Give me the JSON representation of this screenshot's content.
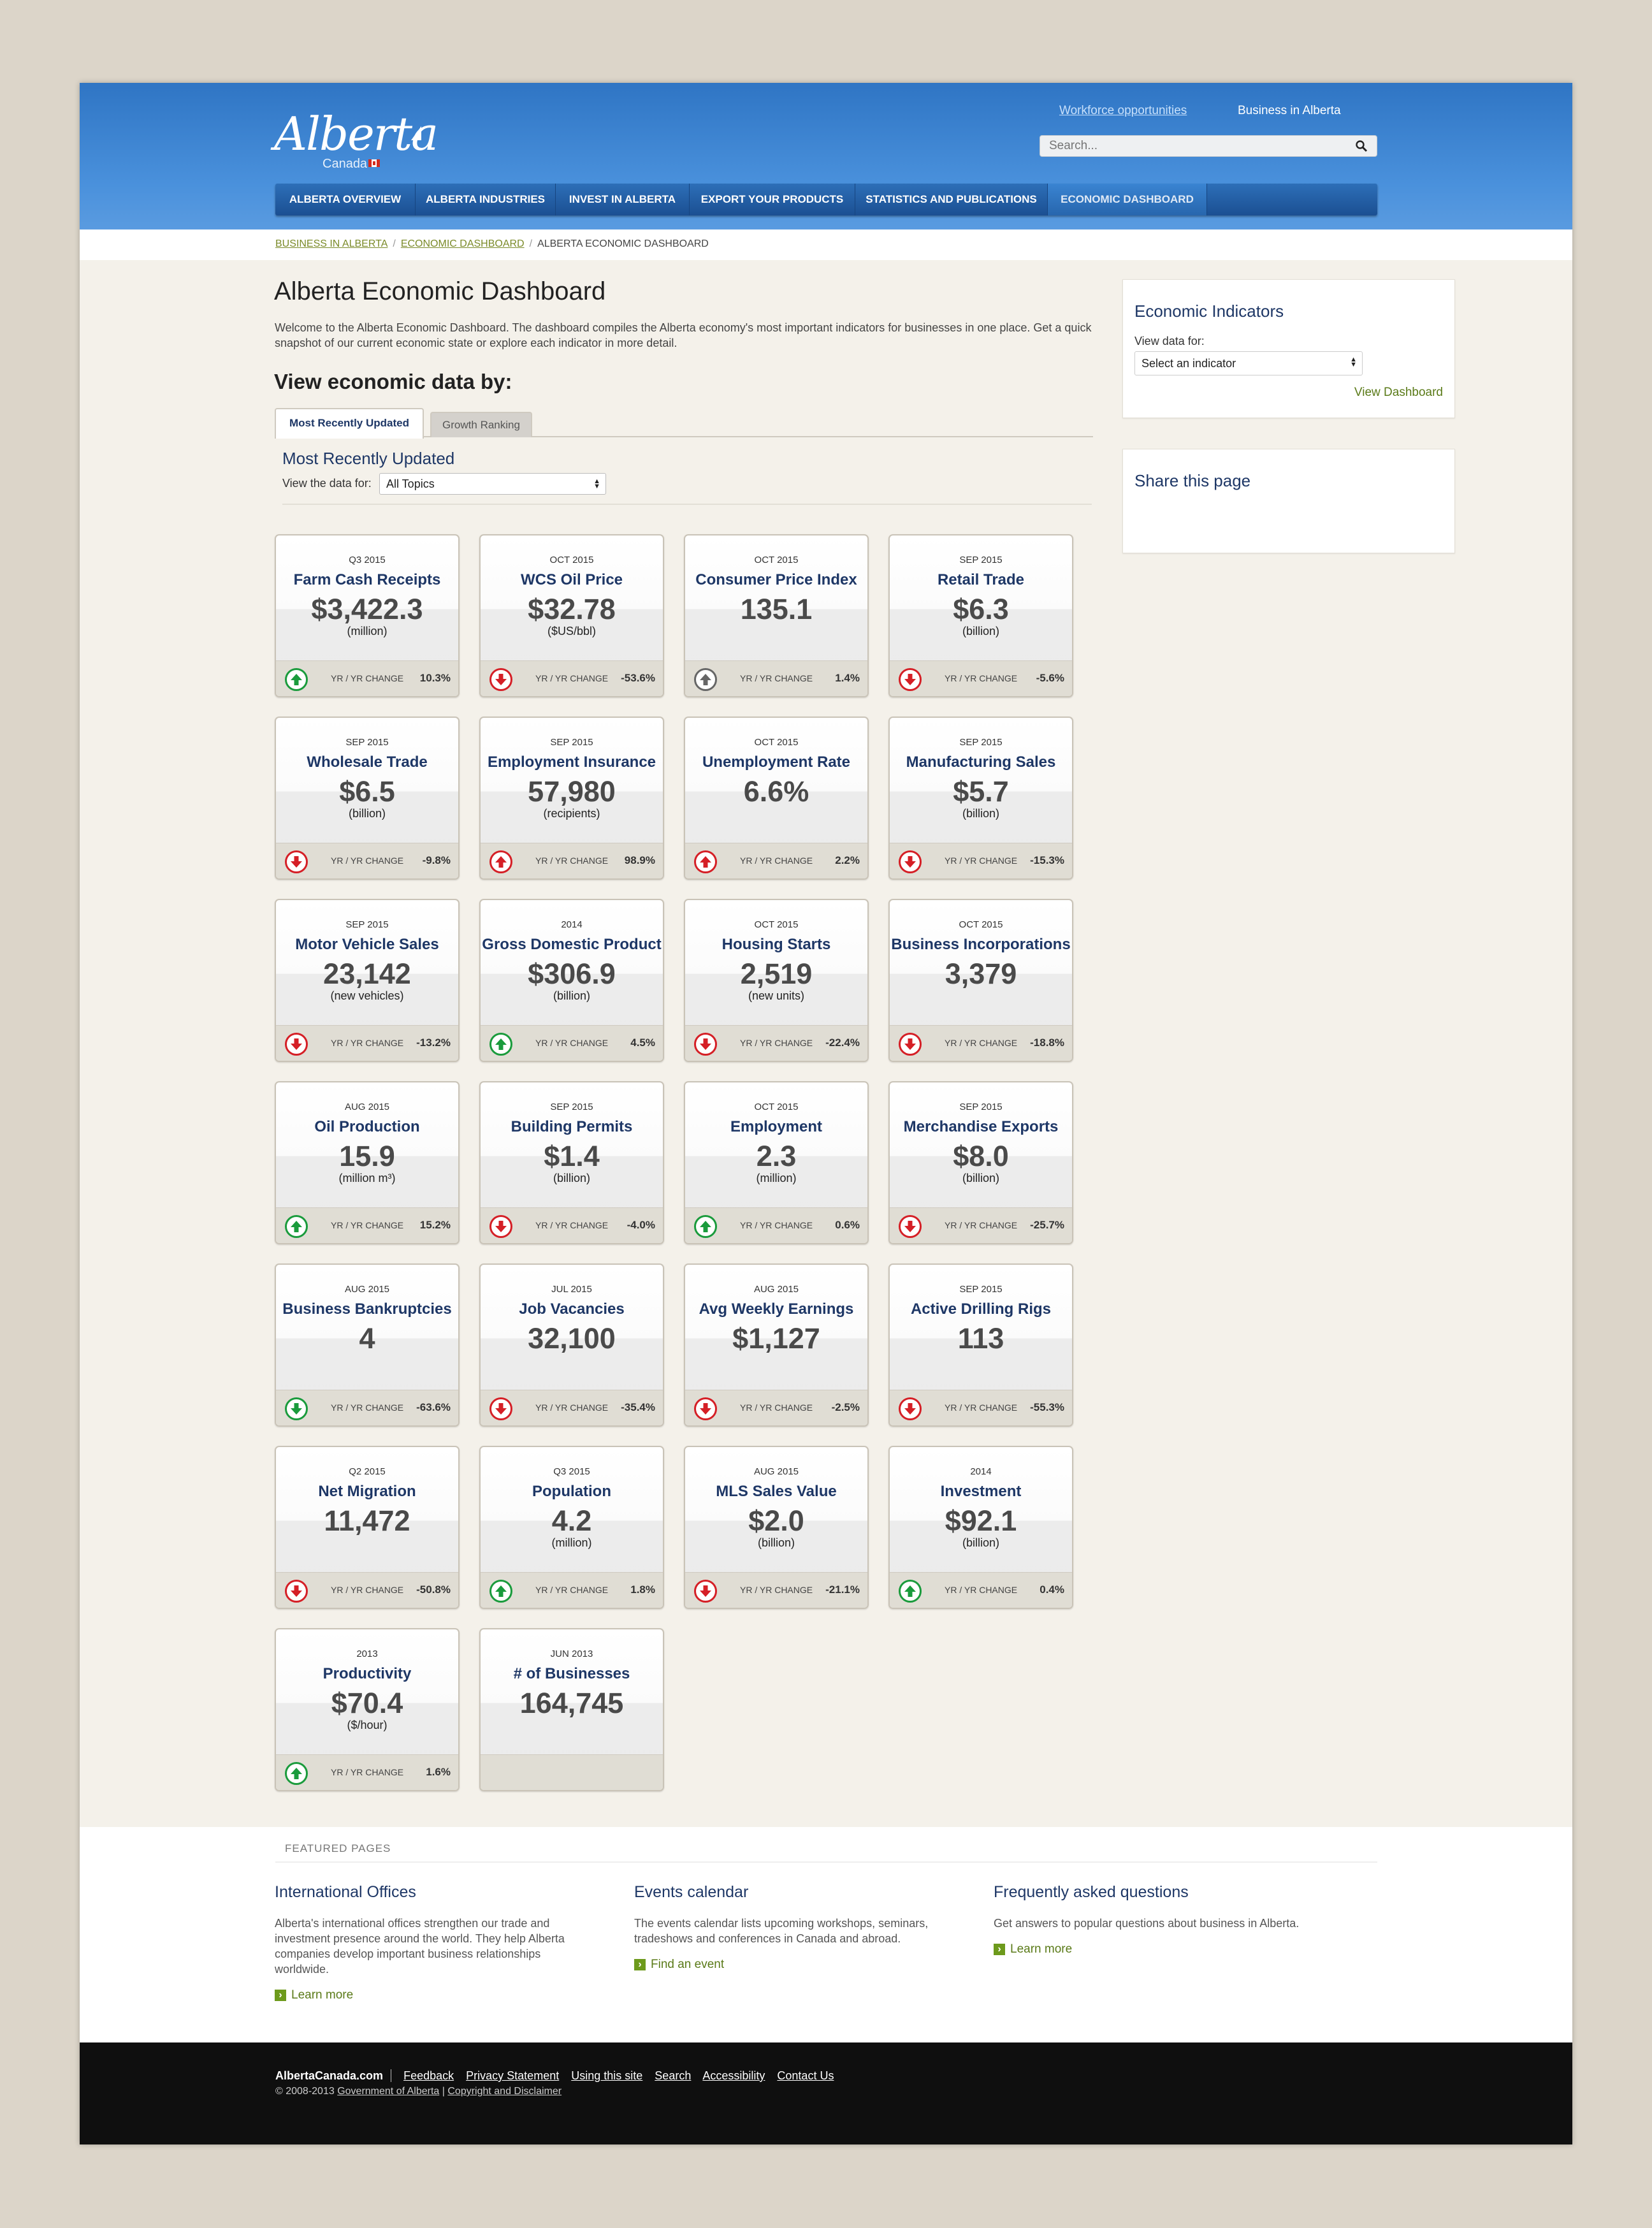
{
  "header": {
    "logo_text": "Alberta",
    "logo_sub": "Canada",
    "workforce_link": "Workforce opportunities",
    "business_link": "Business in Alberta",
    "search_placeholder": "Search..."
  },
  "nav": [
    "ALBERTA OVERVIEW",
    "ALBERTA INDUSTRIES",
    "INVEST IN ALBERTA",
    "EXPORT YOUR PRODUCTS",
    "STATISTICS AND PUBLICATIONS",
    "ECONOMIC DASHBOARD"
  ],
  "breadcrumb": {
    "item1": "BUSINESS IN ALBERTA",
    "item2": "ECONOMIC DASHBOARD",
    "current": "ALBERTA ECONOMIC DASHBOARD"
  },
  "main": {
    "title": "Alberta Economic Dashboard",
    "intro": "Welcome to the Alberta Economic Dashboard. The dashboard compiles the Alberta economy's most important indicators for businesses in one place. Get a quick snapshot of our current economic state or explore each indicator in more detail.",
    "subtitle": "View economic data by:",
    "tab_recent": "Most Recently Updated",
    "tab_growth": "Growth Ranking",
    "section_head": "Most Recently Updated",
    "filter_label": "View the data for:",
    "filter_value": "All Topics",
    "yr_label": "YR / YR CHANGE"
  },
  "cards": [
    {
      "date": "Q3 2015",
      "name": "Farm Cash Receipts",
      "value": "$3,422.3",
      "unit": "(million)",
      "change": "10.3%",
      "dir": "up",
      "tone": "good"
    },
    {
      "date": "OCT 2015",
      "name": "WCS Oil Price",
      "value": "$32.78",
      "unit": "($US/bbl)",
      "change": "-53.6%",
      "dir": "down",
      "tone": "bad"
    },
    {
      "date": "OCT 2015",
      "name": "Consumer Price Index",
      "value": "135.1",
      "unit": "",
      "change": "1.4%",
      "dir": "up",
      "tone": "neutral"
    },
    {
      "date": "SEP 2015",
      "name": "Retail Trade",
      "value": "$6.3",
      "unit": "(billion)",
      "change": "-5.6%",
      "dir": "down",
      "tone": "bad"
    },
    {
      "date": "SEP 2015",
      "name": "Wholesale Trade",
      "value": "$6.5",
      "unit": "(billion)",
      "change": "-9.8%",
      "dir": "down",
      "tone": "bad"
    },
    {
      "date": "SEP 2015",
      "name": "Employment Insurance",
      "value": "57,980",
      "unit": "(recipients)",
      "change": "98.9%",
      "dir": "up",
      "tone": "bad"
    },
    {
      "date": "OCT 2015",
      "name": "Unemployment Rate",
      "value": "6.6%",
      "unit": "",
      "change": "2.2%",
      "dir": "up",
      "tone": "bad"
    },
    {
      "date": "SEP 2015",
      "name": "Manufacturing Sales",
      "value": "$5.7",
      "unit": "(billion)",
      "change": "-15.3%",
      "dir": "down",
      "tone": "bad"
    },
    {
      "date": "SEP 2015",
      "name": "Motor Vehicle Sales",
      "value": "23,142",
      "unit": "(new vehicles)",
      "change": "-13.2%",
      "dir": "down",
      "tone": "bad"
    },
    {
      "date": "2014",
      "name": "Gross Domestic Product",
      "value": "$306.9",
      "unit": "(billion)",
      "change": "4.5%",
      "dir": "up",
      "tone": "good"
    },
    {
      "date": "OCT 2015",
      "name": "Housing Starts",
      "value": "2,519",
      "unit": "(new units)",
      "change": "-22.4%",
      "dir": "down",
      "tone": "bad"
    },
    {
      "date": "OCT 2015",
      "name": "Business Incorporations",
      "value": "3,379",
      "unit": "",
      "change": "-18.8%",
      "dir": "down",
      "tone": "bad"
    },
    {
      "date": "AUG 2015",
      "name": "Oil Production",
      "value": "15.9",
      "unit": "(million m³)",
      "change": "15.2%",
      "dir": "up",
      "tone": "good"
    },
    {
      "date": "SEP 2015",
      "name": "Building Permits",
      "value": "$1.4",
      "unit": "(billion)",
      "change": "-4.0%",
      "dir": "down",
      "tone": "bad"
    },
    {
      "date": "OCT 2015",
      "name": "Employment",
      "value": "2.3",
      "unit": "(million)",
      "change": "0.6%",
      "dir": "up",
      "tone": "good"
    },
    {
      "date": "SEP 2015",
      "name": "Merchandise Exports",
      "value": "$8.0",
      "unit": "(billion)",
      "change": "-25.7%",
      "dir": "down",
      "tone": "bad"
    },
    {
      "date": "AUG 2015",
      "name": "Business Bankruptcies",
      "value": "4",
      "unit": "",
      "change": "-63.6%",
      "dir": "down",
      "tone": "good"
    },
    {
      "date": "JUL 2015",
      "name": "Job Vacancies",
      "value": "32,100",
      "unit": "",
      "change": "-35.4%",
      "dir": "down",
      "tone": "bad"
    },
    {
      "date": "AUG 2015",
      "name": "Avg Weekly Earnings",
      "value": "$1,127",
      "unit": "",
      "change": "-2.5%",
      "dir": "down",
      "tone": "bad"
    },
    {
      "date": "SEP 2015",
      "name": "Active Drilling Rigs",
      "value": "113",
      "unit": "",
      "change": "-55.3%",
      "dir": "down",
      "tone": "bad"
    },
    {
      "date": "Q2 2015",
      "name": "Net Migration",
      "value": "11,472",
      "unit": "",
      "change": "-50.8%",
      "dir": "down",
      "tone": "bad"
    },
    {
      "date": "Q3 2015",
      "name": "Population",
      "value": "4.2",
      "unit": "(million)",
      "change": "1.8%",
      "dir": "up",
      "tone": "good"
    },
    {
      "date": "AUG 2015",
      "name": "MLS Sales Value",
      "value": "$2.0",
      "unit": "(billion)",
      "change": "-21.1%",
      "dir": "down",
      "tone": "bad"
    },
    {
      "date": "2014",
      "name": "Investment",
      "value": "$92.1",
      "unit": "(billion)",
      "change": "0.4%",
      "dir": "up",
      "tone": "good"
    },
    {
      "date": "2013",
      "name": "Productivity",
      "value": "$70.4",
      "unit": "($/hour)",
      "change": "1.6%",
      "dir": "up",
      "tone": "good"
    },
    {
      "date": "JUN 2013",
      "name": "# of Businesses",
      "value": "164,745",
      "unit": "",
      "change": "",
      "dir": "",
      "tone": ""
    }
  ],
  "sidebar": {
    "indicators_title": "Economic Indicators",
    "indicators_label": "View data for:",
    "indicator_select": "Select an indicator",
    "view_dashboard": "View Dashboard",
    "share_title": "Share this page"
  },
  "featured": {
    "label": "FEATURED PAGES",
    "items": [
      {
        "title": "International Offices",
        "text": "Alberta's international offices strengthen our trade and investment presence around the world. They help Alberta companies develop important business relationships worldwide.",
        "link": "Learn more"
      },
      {
        "title": "Events calendar",
        "text": "The events calendar lists upcoming workshops, seminars, tradeshows and conferences in Canada and abroad.",
        "link": "Find an event"
      },
      {
        "title": "Frequently asked questions",
        "text": "Get answers to popular questions about business in Alberta.",
        "link": "Learn more"
      }
    ]
  },
  "footer": {
    "brand": "AlbertaCanada.com",
    "links": [
      "Feedback",
      "Privacy Statement",
      "Using this site",
      "Search",
      "Accessibility",
      "Contact Us"
    ],
    "copy_prefix": "© 2008-2013",
    "copy_gov": "Government of Alberta",
    "copy_sep": "|",
    "copy_disclaimer": "Copyright and Disclaimer"
  },
  "colors": {
    "header_blue": "#2f75c4",
    "nav_blue": "#1b4f92",
    "title_navy": "#1e3766",
    "link_green": "#5a7a18",
    "up_green": "#1a9b3c",
    "down_red": "#d51f26"
  }
}
